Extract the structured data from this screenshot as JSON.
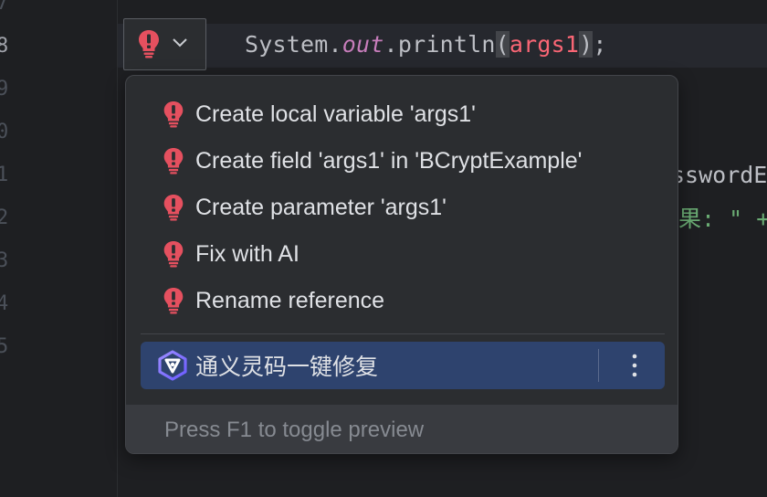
{
  "gutter": {
    "line_numbers": [
      "7",
      "8",
      "9",
      "0",
      "1",
      "2",
      "3",
      "4",
      "5"
    ]
  },
  "editor": {
    "code": {
      "obj": "System",
      "dot1": ".",
      "field": "out",
      "dot2": ".",
      "method": "println",
      "lparen": "(",
      "arg": "args1",
      "rparen": ")",
      "semi": ";"
    },
    "side_text_1": "sswordE",
    "side_text_2": "果: \" +"
  },
  "popup": {
    "items": [
      {
        "label": "Create local variable 'args1'"
      },
      {
        "label": "Create field 'args1' in 'BCryptExample'"
      },
      {
        "label": "Create parameter 'args1'"
      },
      {
        "label": "Fix with AI"
      },
      {
        "label": "Rename reference"
      }
    ],
    "selected_item": {
      "label": "通义灵码一键修复"
    },
    "footer_hint": "Press F1 to toggle preview"
  },
  "colors": {
    "error_red": "#e5505f",
    "selection": "#2e436e",
    "keyword_field": "#c77dbb",
    "string_green": "#6aab73"
  }
}
